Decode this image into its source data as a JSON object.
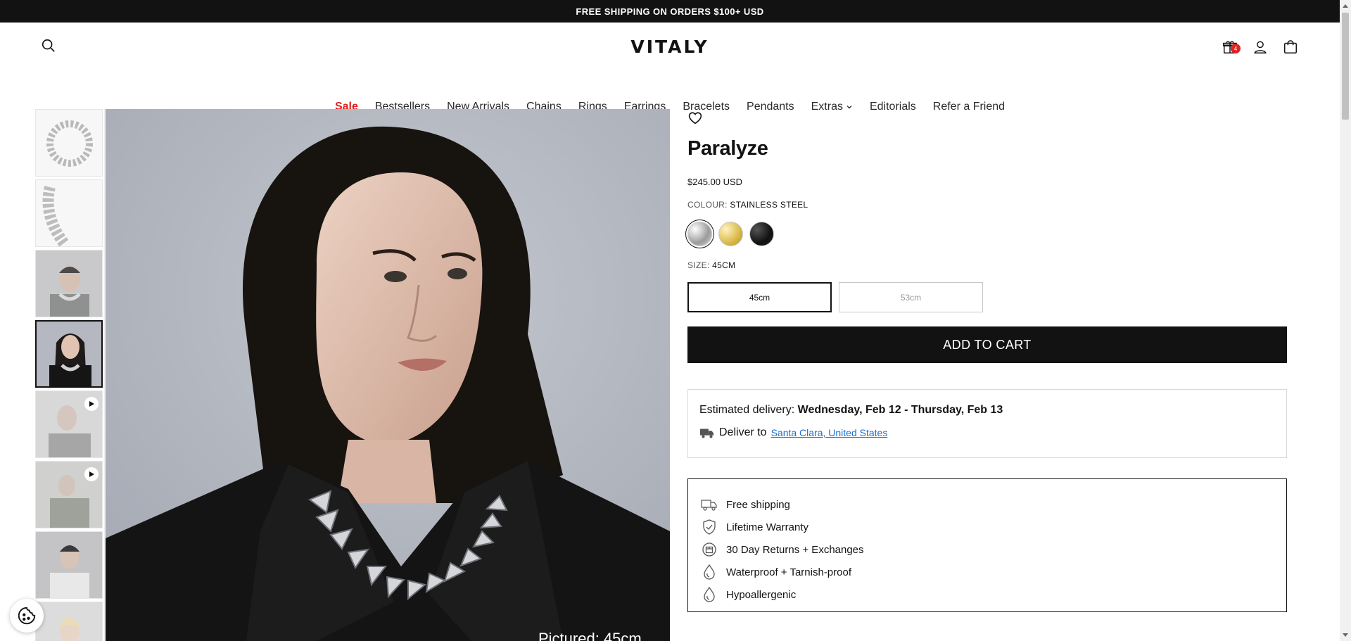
{
  "announcement": "FREE SHIPPING ON ORDERS $100+ USD",
  "header": {
    "logo": "VITALY",
    "gift_badge": "4",
    "icons": [
      "search-icon",
      "gift-icon",
      "account-icon",
      "cart-icon"
    ]
  },
  "nav": {
    "items": [
      {
        "label": "Sale"
      },
      {
        "label": "Bestsellers"
      },
      {
        "label": "New Arrivals"
      },
      {
        "label": "Chains"
      },
      {
        "label": "Rings"
      },
      {
        "label": "Earrings"
      },
      {
        "label": "Bracelets"
      },
      {
        "label": "Pendants"
      },
      {
        "label": "Extras"
      },
      {
        "label": "Editorials"
      },
      {
        "label": "Refer a Friend"
      }
    ]
  },
  "gallery": {
    "pictured": "Pictured: 45cm"
  },
  "product": {
    "title": "Paralyze",
    "price": "$245.00 USD",
    "colour_label": "COLOUR:",
    "colour_value": "STAINLESS STEEL",
    "size_label": "SIZE:",
    "size_value": "45CM",
    "sizes": [
      {
        "label": "45cm"
      },
      {
        "label": "53cm"
      }
    ],
    "add_to_cart": "ADD TO CART",
    "colors": {
      "steel": "#c9c9c9",
      "gold": "#d9b84a",
      "black": "#1a1a1a",
      "accent": "#e22120",
      "link": "#1a6fd1"
    }
  },
  "delivery": {
    "label": "Estimated delivery:",
    "dates": "Wednesday, Feb 12 - Thursday, Feb 13",
    "deliver_to": "Deliver to",
    "location": "Santa Clara, United States"
  },
  "features": [
    {
      "label": "Free shipping",
      "icon": "truck-icon"
    },
    {
      "label": "Lifetime Warranty",
      "icon": "shield-check-icon"
    },
    {
      "label": "30 Day Returns + Exchanges",
      "icon": "return-box-icon"
    },
    {
      "label": "Waterproof + Tarnish-proof",
      "icon": "droplet-icon"
    },
    {
      "label": "Hypoallergenic",
      "icon": "droplet-icon"
    }
  ]
}
